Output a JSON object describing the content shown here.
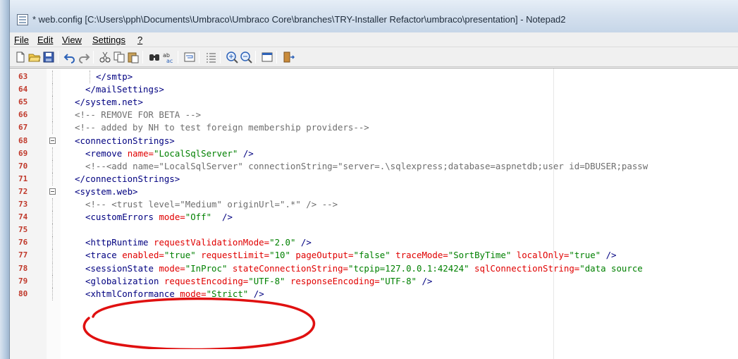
{
  "window": {
    "title": "* web.config [C:\\Users\\pph\\Documents\\Umbraco\\Umbraco Core\\branches\\TRY-Installer Refactor\\umbraco\\presentation] - Notepad2"
  },
  "menu": {
    "items": [
      {
        "label": "File"
      },
      {
        "label": "Edit"
      },
      {
        "label": "View"
      },
      {
        "label": "Settings"
      },
      {
        "label": "?"
      }
    ]
  },
  "toolbar": {
    "buttons": [
      "new-icon",
      "open-icon",
      "save-icon",
      "undo-icon",
      "redo-icon",
      "cut-icon",
      "copy-icon",
      "paste-icon",
      "find-icon",
      "replace-icon",
      "wordwrap-icon",
      "line-numbers-icon",
      "zoom-in-icon",
      "zoom-out-icon",
      "scheme-icon",
      "exit-icon"
    ]
  },
  "colors": {
    "tag": "#000080",
    "attribute": "#e00000",
    "value": "#008000",
    "comment": "#6e6e6e",
    "line_number": "#c0392b",
    "annotation": "#e01010"
  },
  "editor": {
    "lines": [
      {
        "n": "63",
        "fold": "line",
        "indent": 3,
        "tokens": [
          [
            "tag",
            "</smtp>"
          ]
        ]
      },
      {
        "n": "64",
        "fold": "line",
        "indent": 2,
        "tokens": [
          [
            "tag",
            "</mailSettings>"
          ]
        ]
      },
      {
        "n": "65",
        "fold": "line",
        "indent": 1,
        "tokens": [
          [
            "tag",
            "</system.net>"
          ]
        ]
      },
      {
        "n": "66",
        "fold": "line",
        "indent": 1,
        "tokens": [
          [
            "cmt",
            "<!-- REMOVE FOR BETA -->"
          ]
        ]
      },
      {
        "n": "67",
        "fold": "line",
        "indent": 1,
        "tokens": [
          [
            "cmt",
            "<!-- added by NH to test foreign membership providers-->"
          ]
        ]
      },
      {
        "n": "68",
        "fold": "box",
        "indent": 1,
        "tokens": [
          [
            "tag",
            "<connectionStrings>"
          ]
        ]
      },
      {
        "n": "69",
        "fold": "line",
        "indent": 2,
        "tokens": [
          [
            "tag",
            "<remove "
          ],
          [
            "attr",
            "name="
          ],
          [
            "val",
            "\"LocalSqlServer\""
          ],
          [
            "tag",
            " />"
          ]
        ]
      },
      {
        "n": "70",
        "fold": "line",
        "indent": 2,
        "tokens": [
          [
            "cmt",
            "<!--<add name=\"LocalSqlServer\" connectionString=\"server=.\\sqlexpress;database=aspnetdb;user id=DBUSER;passw"
          ]
        ]
      },
      {
        "n": "71",
        "fold": "line",
        "indent": 1,
        "tokens": [
          [
            "tag",
            "</connectionStrings>"
          ]
        ]
      },
      {
        "n": "72",
        "fold": "box",
        "indent": 1,
        "tokens": [
          [
            "tag",
            "<system.web>"
          ]
        ]
      },
      {
        "n": "73",
        "fold": "line",
        "indent": 2,
        "tokens": [
          [
            "cmt",
            "<!-- <trust level=\"Medium\" originUrl=\".*\" /> -->"
          ]
        ]
      },
      {
        "n": "74",
        "fold": "line",
        "indent": 2,
        "tokens": [
          [
            "tag",
            "<customErrors "
          ],
          [
            "attr",
            "mode="
          ],
          [
            "val",
            "\"Off\""
          ],
          [
            "tag",
            "  />"
          ]
        ]
      },
      {
        "n": "75",
        "fold": "line",
        "indent": 0,
        "tokens": []
      },
      {
        "n": "76",
        "fold": "line",
        "indent": 2,
        "tokens": [
          [
            "tag",
            "<httpRuntime "
          ],
          [
            "attr",
            "requestValidationMode="
          ],
          [
            "val",
            "\"2.0\""
          ],
          [
            "tag",
            " />"
          ]
        ]
      },
      {
        "n": "77",
        "fold": "line",
        "indent": 2,
        "tokens": [
          [
            "tag",
            "<trace "
          ],
          [
            "attr",
            "enabled="
          ],
          [
            "val",
            "\"true\""
          ],
          [
            "attr",
            " requestLimit="
          ],
          [
            "val",
            "\"10\""
          ],
          [
            "attr",
            " pageOutput="
          ],
          [
            "val",
            "\"false\""
          ],
          [
            "attr",
            " traceMode="
          ],
          [
            "val",
            "\"SortByTime\""
          ],
          [
            "attr",
            " localOnly="
          ],
          [
            "val",
            "\"true\""
          ],
          [
            "tag",
            " />"
          ]
        ]
      },
      {
        "n": "78",
        "fold": "line",
        "indent": 2,
        "tokens": [
          [
            "tag",
            "<sessionState "
          ],
          [
            "attr",
            "mode="
          ],
          [
            "val",
            "\"InProc\""
          ],
          [
            "attr",
            " stateConnectionString="
          ],
          [
            "val",
            "\"tcpip=127.0.0.1:42424\""
          ],
          [
            "attr",
            " sqlConnectionString="
          ],
          [
            "val",
            "\"data source"
          ]
        ]
      },
      {
        "n": "79",
        "fold": "line",
        "indent": 2,
        "tokens": [
          [
            "tag",
            "<globalization "
          ],
          [
            "attr",
            "requestEncoding="
          ],
          [
            "val",
            "\"UTF-8\""
          ],
          [
            "attr",
            " responseEncoding="
          ],
          [
            "val",
            "\"UTF-8\""
          ],
          [
            "tag",
            " />"
          ]
        ]
      },
      {
        "n": "80",
        "fold": "line",
        "indent": 2,
        "tokens": [
          [
            "tag",
            "<xhtmlConformance "
          ],
          [
            "attr",
            "mode="
          ],
          [
            "val",
            "\"Strict\""
          ],
          [
            "tag",
            " />"
          ]
        ]
      }
    ]
  }
}
